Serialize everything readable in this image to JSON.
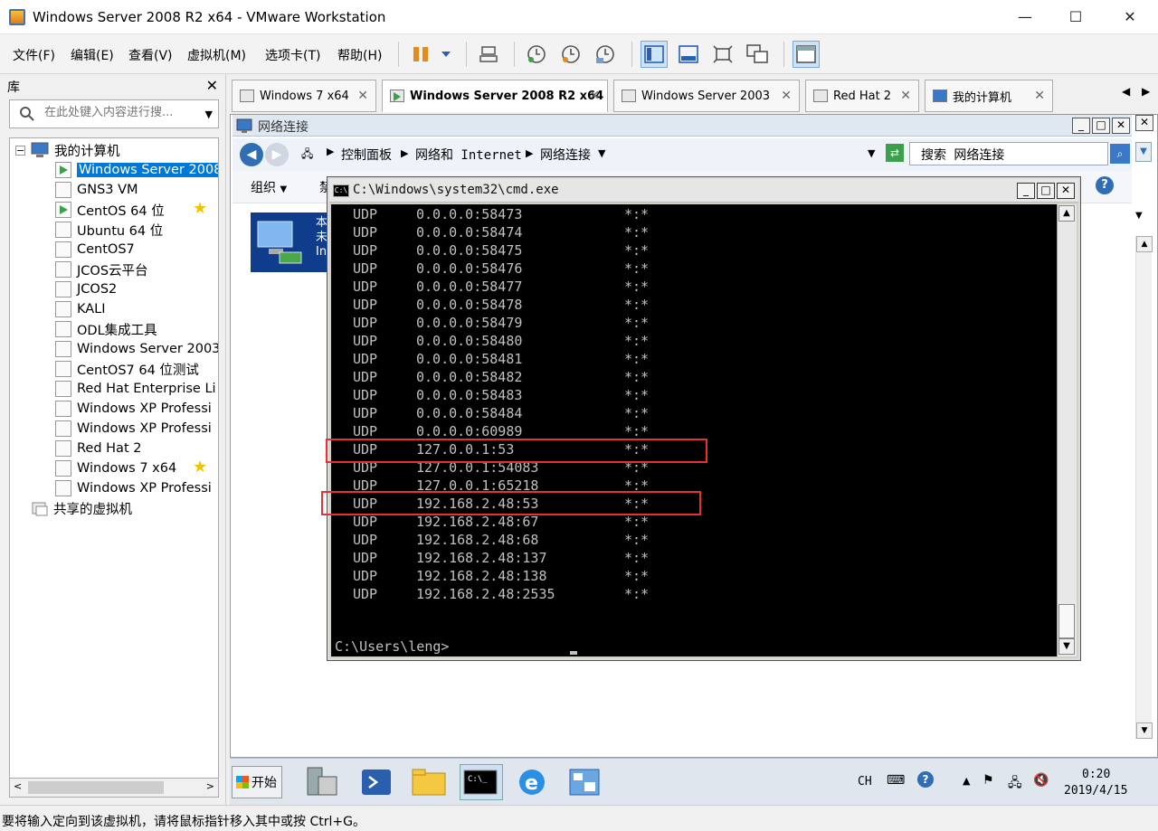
{
  "window": {
    "title": "Windows Server 2008 R2 x64 - VMware Workstation",
    "minimize": "—",
    "maximize": "☐",
    "close": "✕"
  },
  "menu": [
    "文件(F)",
    "编辑(E)",
    "查看(V)",
    "虚拟机(M)",
    "选项卡(T)",
    "帮助(H)"
  ],
  "library": {
    "title": "库",
    "close": "✕",
    "search_placeholder": "在此处键入内容进行搜...",
    "root": "我的计算机",
    "items": [
      {
        "label": "Windows Server 2008",
        "running": true,
        "selected": true,
        "star": false
      },
      {
        "label": "GNS3 VM",
        "running": false,
        "selected": false,
        "star": false
      },
      {
        "label": "CentOS 64 位",
        "running": true,
        "selected": false,
        "star": true
      },
      {
        "label": "Ubuntu 64 位",
        "running": false,
        "selected": false,
        "star": false
      },
      {
        "label": "CentOS7",
        "running": false,
        "selected": false,
        "star": false
      },
      {
        "label": "JCOS云平台",
        "running": false,
        "selected": false,
        "star": false
      },
      {
        "label": "JCOS2",
        "running": false,
        "selected": false,
        "star": false
      },
      {
        "label": "KALI",
        "running": false,
        "selected": false,
        "star": false
      },
      {
        "label": "ODL集成工具",
        "running": false,
        "selected": false,
        "star": false
      },
      {
        "label": "Windows Server 2003",
        "running": false,
        "selected": false,
        "star": false
      },
      {
        "label": "CentOS7 64 位测试",
        "running": false,
        "selected": false,
        "star": false
      },
      {
        "label": "Red Hat Enterprise Li",
        "running": false,
        "selected": false,
        "star": false
      },
      {
        "label": "Windows XP Professi",
        "running": false,
        "selected": false,
        "star": false
      },
      {
        "label": "Windows XP Professi",
        "running": false,
        "selected": false,
        "star": false
      },
      {
        "label": "Red Hat 2",
        "running": false,
        "selected": false,
        "star": false
      },
      {
        "label": "Windows 7 x64",
        "running": false,
        "selected": false,
        "star": true
      },
      {
        "label": "Windows XP Professi",
        "running": false,
        "selected": false,
        "star": false
      }
    ],
    "shared": "共享的虚拟机"
  },
  "tabs": [
    {
      "label": "Windows 7 x64",
      "active": false
    },
    {
      "label": "Windows Server 2008 R2 x64",
      "active": true
    },
    {
      "label": "Windows Server 2003",
      "active": false
    },
    {
      "label": "Red Hat 2",
      "active": false
    },
    {
      "label": "我的计算机",
      "active": false
    }
  ],
  "explorer": {
    "title": "网络连接",
    "breadcrumbs": [
      "控制面板",
      "网络和 Internet",
      "网络连接"
    ],
    "search": "搜索 网络连接",
    "organize": "组织",
    "organize_arrow": "▼",
    "truncated": "禁",
    "adapter_text": [
      "本",
      "未",
      "In"
    ]
  },
  "cmd": {
    "title": "C:\\Windows\\system32\\cmd.exe",
    "lines": [
      {
        "proto": "UDP",
        "local": "0.0.0.0:58473",
        "foreign": "*:*"
      },
      {
        "proto": "UDP",
        "local": "0.0.0.0:58474",
        "foreign": "*:*"
      },
      {
        "proto": "UDP",
        "local": "0.0.0.0:58475",
        "foreign": "*:*"
      },
      {
        "proto": "UDP",
        "local": "0.0.0.0:58476",
        "foreign": "*:*"
      },
      {
        "proto": "UDP",
        "local": "0.0.0.0:58477",
        "foreign": "*:*"
      },
      {
        "proto": "UDP",
        "local": "0.0.0.0:58478",
        "foreign": "*:*"
      },
      {
        "proto": "UDP",
        "local": "0.0.0.0:58479",
        "foreign": "*:*"
      },
      {
        "proto": "UDP",
        "local": "0.0.0.0:58480",
        "foreign": "*:*"
      },
      {
        "proto": "UDP",
        "local": "0.0.0.0:58481",
        "foreign": "*:*"
      },
      {
        "proto": "UDP",
        "local": "0.0.0.0:58482",
        "foreign": "*:*"
      },
      {
        "proto": "UDP",
        "local": "0.0.0.0:58483",
        "foreign": "*:*"
      },
      {
        "proto": "UDP",
        "local": "0.0.0.0:58484",
        "foreign": "*:*"
      },
      {
        "proto": "UDP",
        "local": "0.0.0.0:60989",
        "foreign": "*:*"
      },
      {
        "proto": "UDP",
        "local": "127.0.0.1:53",
        "foreign": "*:*"
      },
      {
        "proto": "UDP",
        "local": "127.0.0.1:54083",
        "foreign": "*:*"
      },
      {
        "proto": "UDP",
        "local": "127.0.0.1:65218",
        "foreign": "*:*"
      },
      {
        "proto": "UDP",
        "local": "192.168.2.48:53",
        "foreign": "*:*"
      },
      {
        "proto": "UDP",
        "local": "192.168.2.48:67",
        "foreign": "*:*"
      },
      {
        "proto": "UDP",
        "local": "192.168.2.48:68",
        "foreign": "*:*"
      },
      {
        "proto": "UDP",
        "local": "192.168.2.48:137",
        "foreign": "*:*"
      },
      {
        "proto": "UDP",
        "local": "192.168.2.48:138",
        "foreign": "*:*"
      },
      {
        "proto": "UDP",
        "local": "192.168.2.48:2535",
        "foreign": "*:*"
      }
    ],
    "prompt": "C:\\Users\\leng>"
  },
  "taskbar": {
    "start": "开始",
    "lang": "CH",
    "time": "0:20",
    "date": "2019/4/15"
  },
  "status": {
    "text": "要将输入定向到该虚拟机，请将鼠标指针移入其中或按 Ctrl+G。"
  },
  "colors": {
    "highlight": "#e53333",
    "selection": "#0078d7",
    "cmd_bg": "#000000",
    "cmd_text": "#c0c0c0"
  }
}
